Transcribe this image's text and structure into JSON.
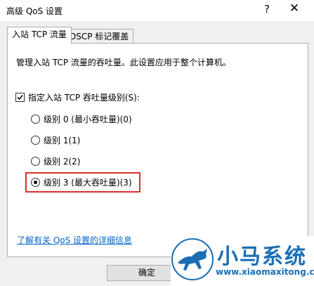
{
  "window": {
    "title": "高级 QoS 设置",
    "help_label": "?",
    "close_label": "✕"
  },
  "tabs": [
    {
      "label": "入站 TCP 流量",
      "active": true
    },
    {
      "label": "DSCP 标记覆盖",
      "active": false
    }
  ],
  "description": "管理入站 TCP 流量的吞吐量。此设置应用于整个计算机。",
  "throughput_checkbox": {
    "label": "指定入站 TCP 吞吐量级别(S):",
    "checked": true
  },
  "levels": [
    {
      "label": "级别 0 (最小吞吐量)(0)",
      "selected": false
    },
    {
      "label": "级别 1(1)",
      "selected": false
    },
    {
      "label": "级别 2(2)",
      "selected": false
    },
    {
      "label": "级别 3 (最大吞吐量)(3)",
      "selected": true
    }
  ],
  "help_link": "了解有关 QoS 设置的详细信息",
  "buttons": {
    "ok": "确定"
  },
  "watermark": {
    "brand": "小马系统",
    "url": "www.xiaomaxitong.com"
  },
  "colors": {
    "highlight": "#d9302c",
    "link": "#0066cc",
    "watermark": "#1a6fb4"
  }
}
